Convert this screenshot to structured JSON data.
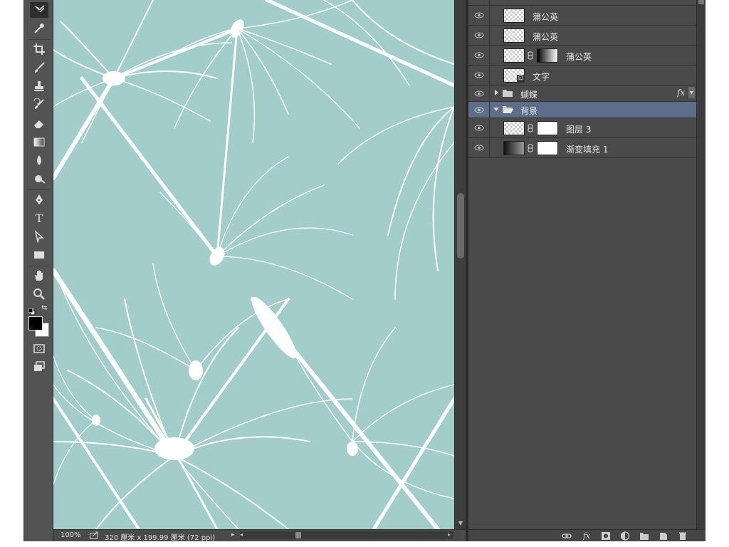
{
  "status_bar": {
    "zoom": "100%",
    "doc_info": "320 厘米 x 199.99 厘米 (72 ppi)"
  },
  "tools": [
    {
      "name": "path-select-icon"
    },
    {
      "name": "eyedropper-icon"
    },
    {
      "name": "crop-icon"
    },
    {
      "name": "brush-icon"
    },
    {
      "name": "stamp-icon"
    },
    {
      "name": "history-brush-icon"
    },
    {
      "name": "eraser-icon"
    },
    {
      "name": "gradient-icon"
    },
    {
      "name": "blur-icon"
    },
    {
      "name": "dodge-icon"
    },
    {
      "name": "pen-icon"
    },
    {
      "name": "type-icon",
      "label": "T"
    },
    {
      "name": "direct-select-icon"
    },
    {
      "name": "rectangle-icon"
    },
    {
      "name": "hand-icon"
    },
    {
      "name": "zoom-icon"
    },
    {
      "name": "quick-mask-icon"
    },
    {
      "name": "screen-mode-icon"
    }
  ],
  "layers": {
    "items": [
      {
        "name": "蒲公英",
        "thumb": "transparent",
        "mask": null
      },
      {
        "name": "蒲公英",
        "thumb": "transparent",
        "mask": null
      },
      {
        "name": "蒲公英",
        "thumb": "transparent",
        "mask": "gradient"
      },
      {
        "name": "文字",
        "thumb": "smart-object",
        "mask": null
      },
      {
        "name": "蝴蝶",
        "type": "group",
        "expanded": false,
        "fx": "fx"
      },
      {
        "name": "背景",
        "type": "group",
        "expanded": true,
        "selected": true
      },
      {
        "name": "图层 3",
        "thumb": "transparent",
        "mask": "white"
      },
      {
        "name": "渐变填充 1",
        "thumb": "gradient-fill",
        "mask": "white"
      }
    ]
  },
  "colors": {
    "canvas_bg": "#a2cdcb",
    "panel_bg": "#4a4a4a",
    "selected_row": "#5d6d8a",
    "foreground_color": "#000000",
    "background_color": "#ffffff"
  }
}
